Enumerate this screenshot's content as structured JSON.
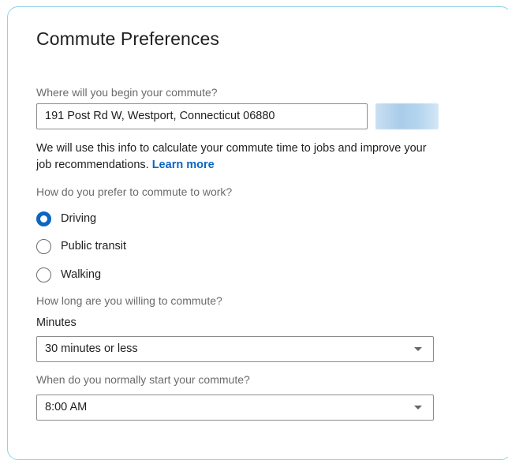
{
  "title": "Commute Preferences",
  "start": {
    "label": "Where will you begin your commute?",
    "value": "191 Post Rd W, Westport, Connecticut 06880"
  },
  "info": {
    "text": "We will use this info to calculate your commute time to jobs and improve your job recommendations.",
    "link": "Learn more"
  },
  "mode": {
    "label": "How do you prefer to commute to work?",
    "options": [
      "Driving",
      "Public transit",
      "Walking"
    ],
    "selected": "Driving"
  },
  "duration": {
    "label": "How long are you willing to commute?",
    "sublabel": "Minutes",
    "value": "30 minutes or less"
  },
  "start_time": {
    "label": "When do you normally start your commute?",
    "value": "8:00 AM"
  },
  "colors": {
    "accent": "#0a66c2",
    "card_border": "#8fd3e8"
  }
}
